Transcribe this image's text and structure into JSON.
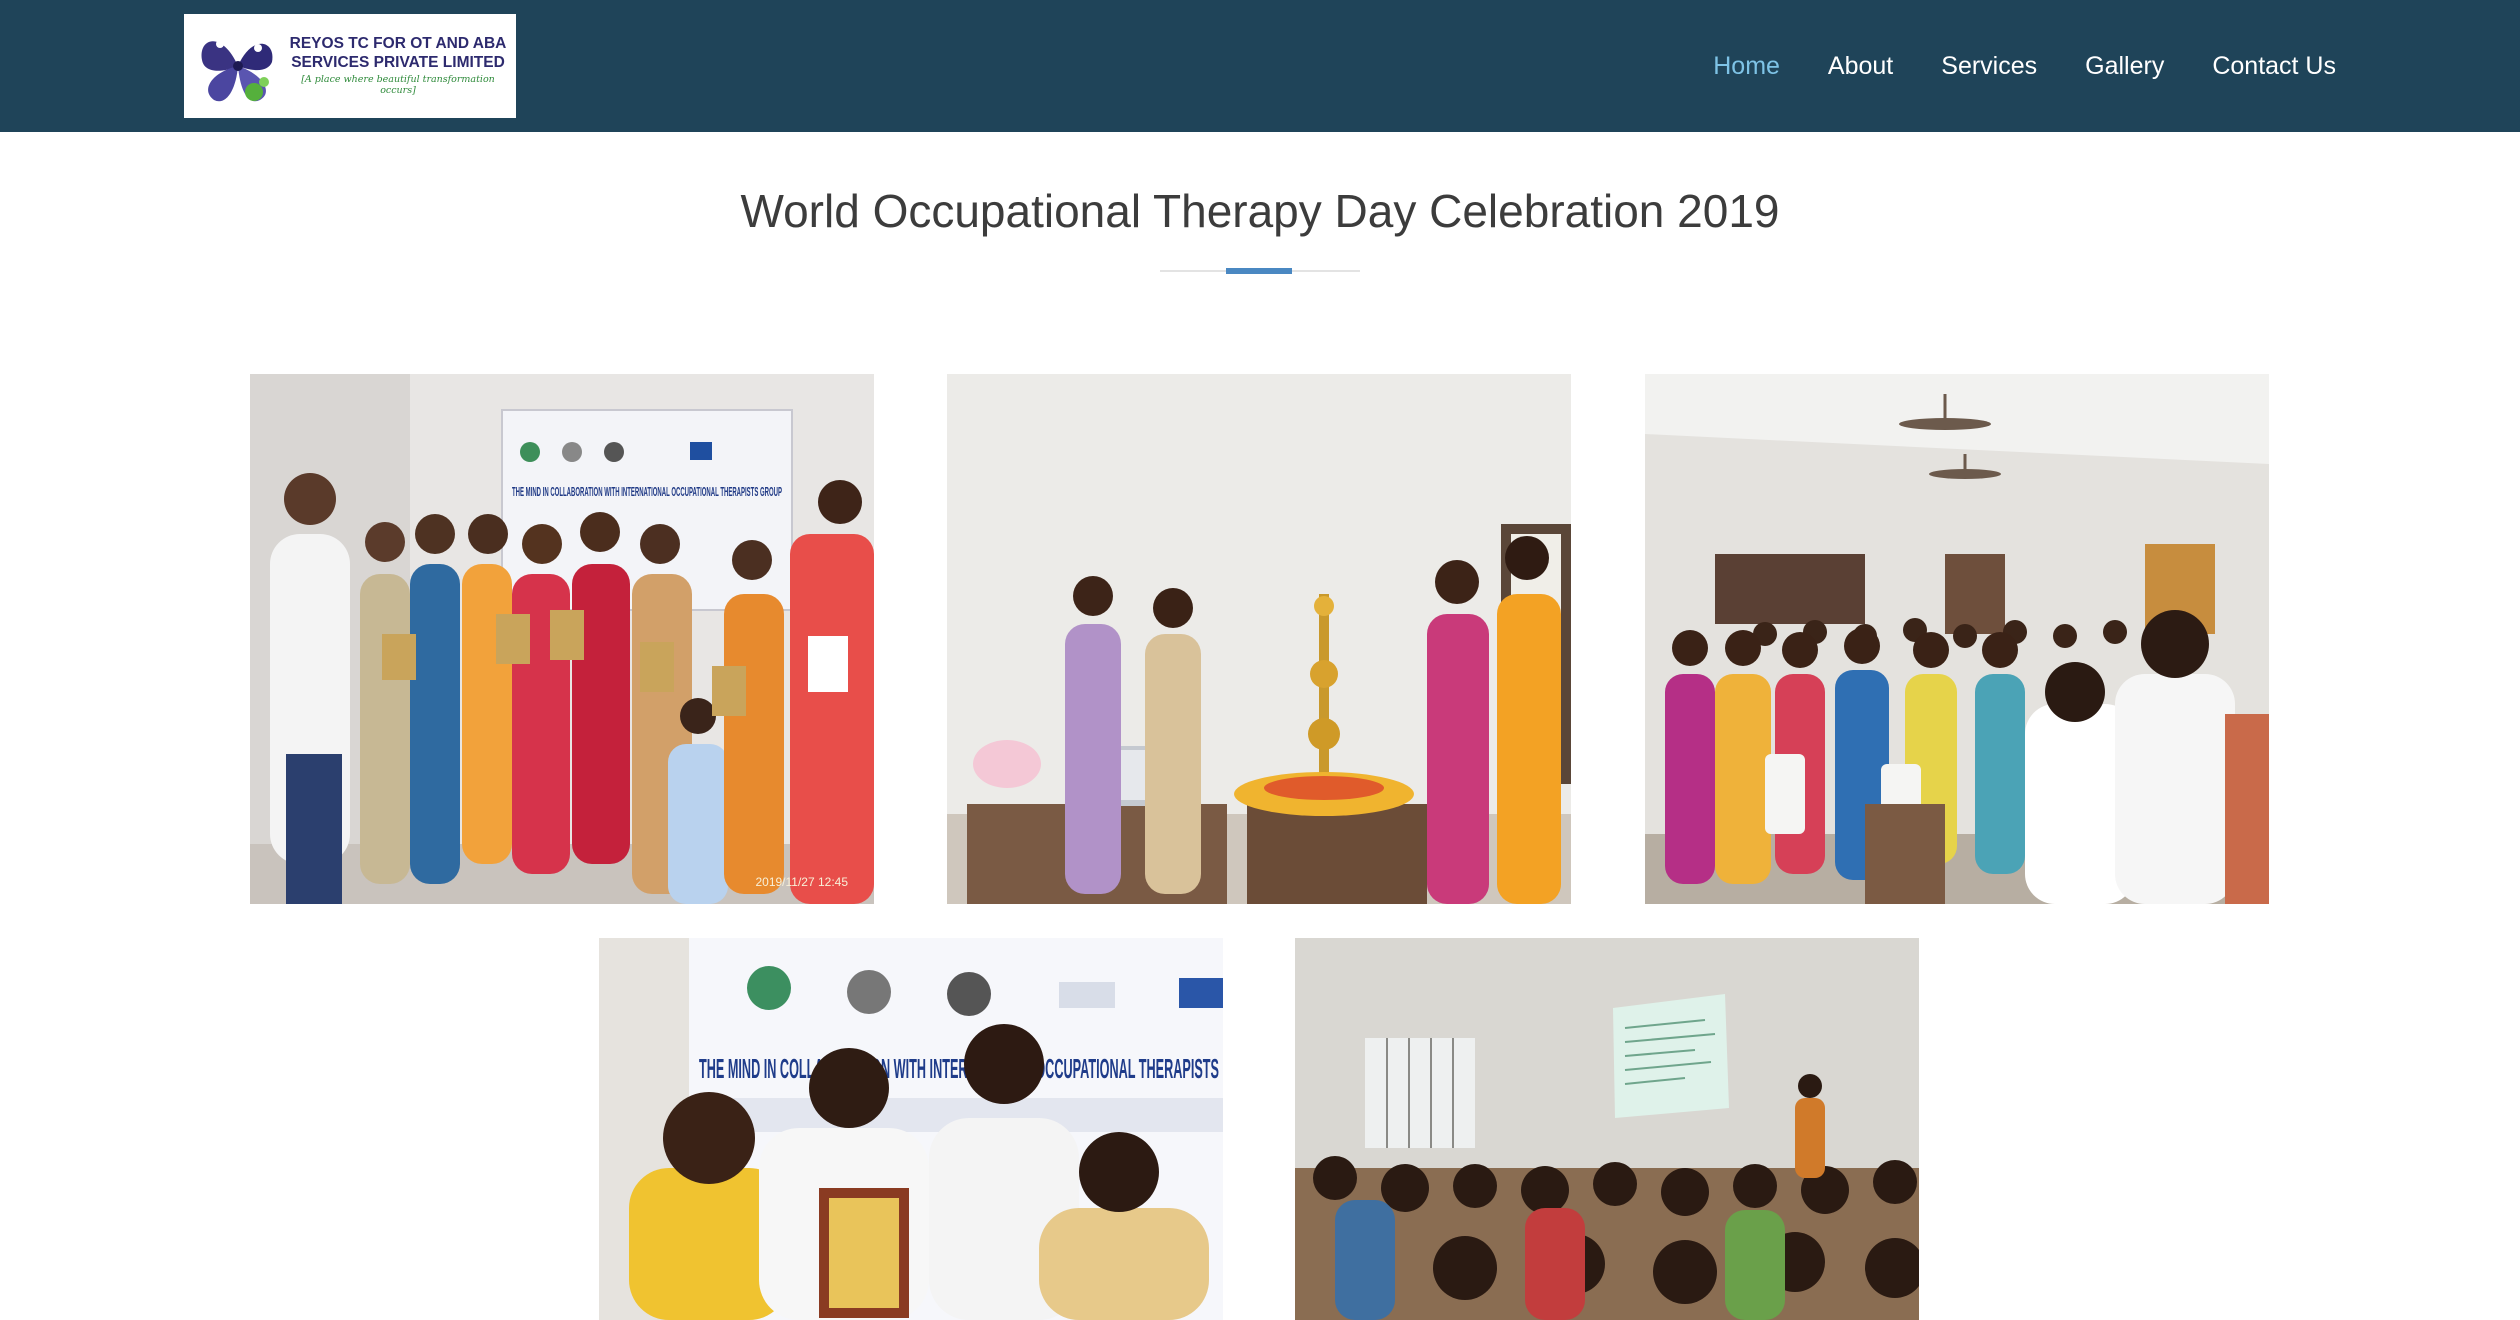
{
  "brand": {
    "line1": "REYOS TC FOR OT AND ABA",
    "line2": "SERVICES PRIVATE LIMITED",
    "tagline": "[A place where beautiful transformation occurs]"
  },
  "nav": {
    "items": [
      {
        "label": "Home",
        "active": true
      },
      {
        "label": "About",
        "active": false
      },
      {
        "label": "Services",
        "active": false
      },
      {
        "label": "Gallery",
        "active": false
      },
      {
        "label": "Contact Us",
        "active": false
      }
    ]
  },
  "colors": {
    "header_bg": "#1f4459",
    "nav_active": "#7ec3e6",
    "accent": "#4a88c2"
  },
  "page": {
    "title": "World Occupational Therapy Day Celebration 2019"
  },
  "gallery": {
    "photos": [
      {
        "banner": "THE MIND IN COLLABORATION WITH INTERNATIONAL OCCUPATIONAL THERAPISTS GROUP",
        "timestamp": "2019/11/27 12:45"
      },
      {},
      {},
      {
        "banner": "THE MIND IN COLLABORATION WITH INTERNATIONAL OCCUPATIONAL THERAPISTS"
      },
      {}
    ]
  }
}
